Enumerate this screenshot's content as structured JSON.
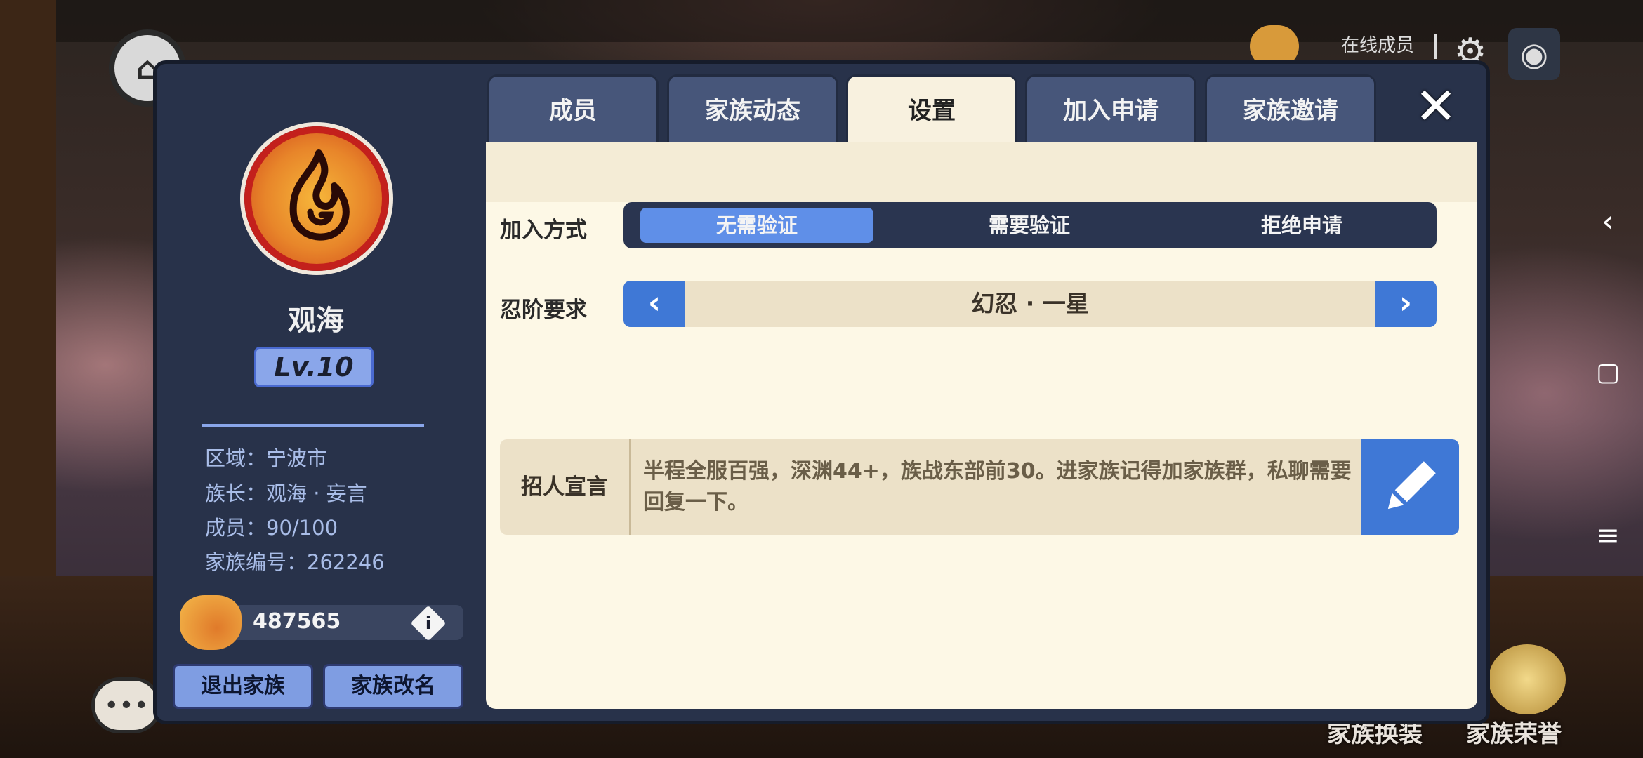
{
  "hud": {
    "online_label": "在线成员"
  },
  "bottom_right": {
    "outfit_label": "家族换装",
    "honor_label": "家族荣誉"
  },
  "sidebar": {
    "family_name": "观海",
    "level": "Lv.10",
    "region": "区域：宁波市",
    "leader": "族长：观海 · 妄言",
    "members": "成员：90/100",
    "family_id": "家族编号：262246",
    "funds": "487565",
    "info_icon_glyph": "i",
    "quit_label": "退出家族",
    "rename_label": "家族改名"
  },
  "tabs": [
    {
      "label": "成员"
    },
    {
      "label": "家族动态"
    },
    {
      "label": "设置"
    },
    {
      "label": "加入申请"
    },
    {
      "label": "家族邀请"
    }
  ],
  "active_tab": "设置",
  "settings": {
    "join_method_label": "加入方式",
    "join_options": [
      "无需验证",
      "需要验证",
      "拒绝申请"
    ],
    "join_selected": "无需验证",
    "rank_label": "忍阶要求",
    "rank_value": "幻忍 · 一星",
    "recruit_label": "招人宣言",
    "recruit_text": "半程全服百强，深渊44+，族战东部前30。进家族记得加家族群，私聊需要回复一下。"
  },
  "colors": {
    "accent_blue": "#3f78d6",
    "segment_active": "#5f8fe8",
    "panel_bg": "#28324a",
    "content_bg": "#fdf8e6",
    "emblem_red": "#c3201c"
  }
}
